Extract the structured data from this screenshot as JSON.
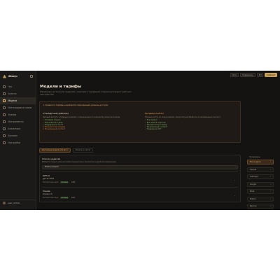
{
  "app": {
    "name": "Абакус"
  },
  "sidebar": {
    "items": [
      {
        "label": "Чат"
      },
      {
        "label": "Агенты"
      },
      {
        "label": "Модели"
      },
      {
        "label": "Интеграции и ключи"
      },
      {
        "label": "Знания"
      },
      {
        "label": "Инструменты"
      },
      {
        "label": "Аналитика"
      },
      {
        "label": "Биллинг"
      },
      {
        "label": "Настройки"
      }
    ],
    "user": "user_admin"
  },
  "topbar": {
    "buttons": [
      "Docs",
      "Поддержка",
      "RU",
      "Кабинет"
    ]
  },
  "page": {
    "title": "Модели и тарифы",
    "subtitle": "Управление доступными моделями, лимитами и тарифными планами для вашего рабочего пространства."
  },
  "promo": {
    "headline": "⚠ Сравните тарифы и выберите подходящий уровень доступа",
    "plans": [
      {
        "name": "Стандартный ($20/мес)",
        "desc": "Базовый доступ к основным моделям с ограничением по количеству запросов в месяц.",
        "features": [
          "✓ Основные модели",
          "✓ 500 запросов в день",
          "✓ Поддержка по почте",
          "✗ Приоритетная очередь",
          "✗ Расширенный контекст"
        ]
      },
      {
        "name": "Продвинутый Pro",
        "desc": "Полный доступ ко всем моделям, приоритетная обработка и расширенный контекст.",
        "features": [
          "✓ Все модели",
          "✓ Без лимита запросов",
          "✓ Приоритетная очередь",
          "✓ Расширенный контекст",
          "✓ Поддержка 24/7"
        ]
      }
    ]
  },
  "tabs": [
    {
      "label": "Доступные модели (12 шт.)"
    },
    {
      "label": "Лимиты и квоты"
    }
  ],
  "models_panel": {
    "title": "Список моделей",
    "subtitle": "Выберите модель для настройки параметров и просмотра подробной информации.",
    "selected": "Выбор модели",
    "models": [
      {
        "name": "GPT-4o",
        "id": "gpt-4o-2024",
        "context_label": "Контекстное окно:",
        "status": "Активна",
        "note": "128k"
      },
      {
        "name": "Claude",
        "id": "claude-3.5",
        "context_label": "Контекстное окно:",
        "status": "Активна",
        "note": "200k"
      }
    ]
  },
  "right_sidebar": {
    "title": "Провайдеры",
    "items": [
      "Все модели",
      "OpenAI",
      "Anthropic",
      "Google",
      "Meta",
      "Mistral",
      "Другие"
    ]
  }
}
